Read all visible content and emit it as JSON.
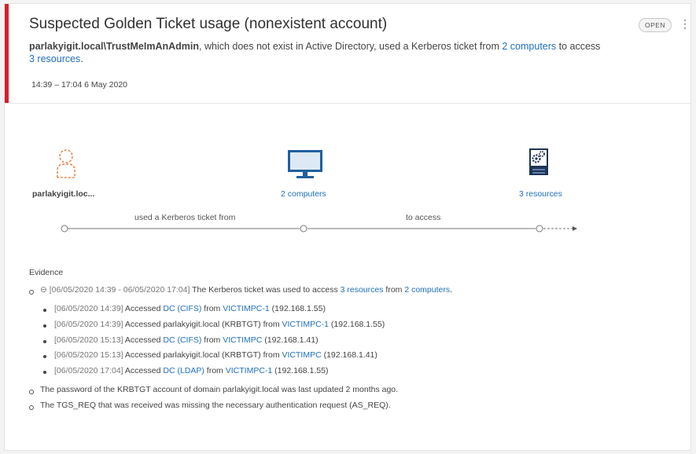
{
  "alert": {
    "title": "Suspected Golden Ticket usage (nonexistent account)",
    "status": "OPEN",
    "more": "⋮",
    "summary": {
      "account": "parlakyigit.local\\TrustMeImAnAdmin",
      "text1": ", which does not exist in Active Directory, used a Kerberos ticket from ",
      "computers_link": "2 computers",
      "text2": " to access",
      "resources_link": "3 resources",
      "text3": "."
    },
    "time_range": "14:39 – 17:04 6 May 2020"
  },
  "diagram": {
    "nodes": [
      {
        "label": "parlakyigit.loc...",
        "icon": "user-icon",
        "link": false
      },
      {
        "label": "2 computers",
        "icon": "monitor-icon",
        "link": true
      },
      {
        "label": "3 resources",
        "icon": "server-gear-icon",
        "link": true
      }
    ],
    "edges": [
      {
        "label": "used a Kerberos ticket from"
      },
      {
        "label": "to access"
      }
    ]
  },
  "evidence": {
    "title": "Evidence",
    "group": {
      "toggle": "⊖",
      "time": "[06/05/2020 14:39 - 06/05/2020 17:04]",
      "text1": " The Kerberos ticket was used to access ",
      "resources_link": "3 resources",
      "text2": " from ",
      "computers_link": "2 computers",
      "text3": "."
    },
    "items": [
      {
        "time": "[06/05/2020 14:39]",
        "accessed": " Accessed ",
        "resource": "DC (CIFS)",
        "resource_link": true,
        "from": " from ",
        "computer": "VICTIMPC-1",
        "ip": " (192.168.1.55)"
      },
      {
        "time": "[06/05/2020 14:39]",
        "accessed": " Accessed ",
        "resource": "parlakyigit.local (KRBTGT)",
        "resource_link": false,
        "from": " from ",
        "computer": "VICTIMPC-1",
        "ip": " (192.168.1.55)"
      },
      {
        "time": "[06/05/2020 15:13]",
        "accessed": " Accessed ",
        "resource": "DC (CIFS)",
        "resource_link": true,
        "from": " from ",
        "computer": "VICTIMPC",
        "ip": " (192.168.1.41)"
      },
      {
        "time": "[06/05/2020 15:13]",
        "accessed": " Accessed ",
        "resource": "parlakyigit.local (KRBTGT)",
        "resource_link": false,
        "from": " from ",
        "computer": "VICTIMPC",
        "ip": " (192.168.1.41)"
      },
      {
        "time": "[06/05/2020 17:04]",
        "accessed": " Accessed ",
        "resource": "DC (LDAP)",
        "resource_link": true,
        "from": " from ",
        "computer": "VICTIMPC-1",
        "ip": " (192.168.1.55)"
      }
    ],
    "notes": [
      "The password of the KRBTGT account of domain parlakyigit.local was last updated 2 months ago.",
      "The TGS_REQ that was received was missing the necessary authentication request (AS_REQ)."
    ]
  },
  "colors": {
    "accent_red": "#d81e2c",
    "link_blue": "#1f6fbf",
    "user_orange": "#e8702a",
    "monitor_blue": "#1f5f9f"
  }
}
